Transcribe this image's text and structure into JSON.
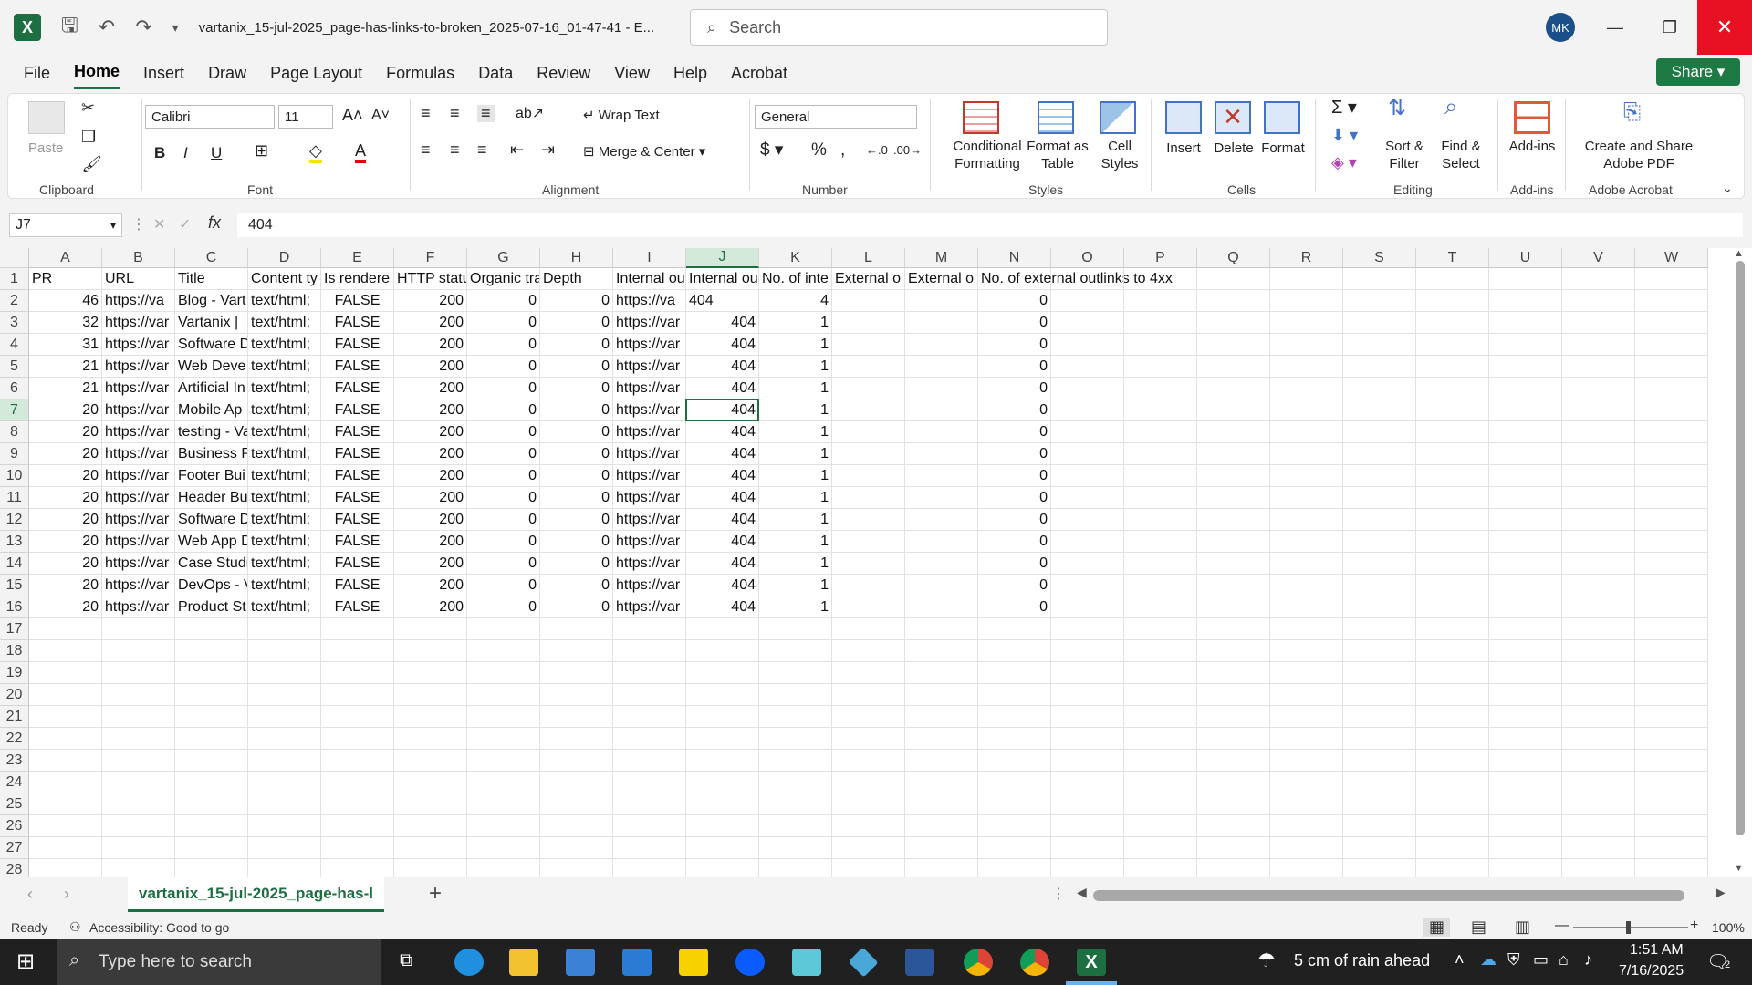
{
  "titlebar": {
    "doc_title": "vartanix_15-jul-2025_page-has-links-to-broken_2025-07-16_01-47-41  -  E...",
    "search_placeholder": "Search",
    "avatar_initials": "MK"
  },
  "menu": [
    "File",
    "Home",
    "Insert",
    "Draw",
    "Page Layout",
    "Formulas",
    "Data",
    "Review",
    "View",
    "Help",
    "Acrobat"
  ],
  "share_label": "Share",
  "ribbon": {
    "paste": "Paste",
    "font_name": "Calibri",
    "font_size": "11",
    "wrap_text": "Wrap Text",
    "merge_center": "Merge & Center",
    "number_format": "General",
    "conditional_formatting": "Conditional Formatting",
    "format_as_table": "Format as Table",
    "cell_styles": "Cell Styles",
    "insert": "Insert",
    "delete": "Delete",
    "format": "Format",
    "sort_filter": "Sort & Filter",
    "find_select": "Find & Select",
    "addins": "Add-ins",
    "create_pdf": "Create and Share Adobe PDF",
    "groups": {
      "clipboard": "Clipboard",
      "font": "Font",
      "alignment": "Alignment",
      "number": "Number",
      "styles": "Styles",
      "cells": "Cells",
      "editing": "Editing",
      "addins": "Add-ins",
      "acrobat": "Adobe Acrobat"
    }
  },
  "formula_bar": {
    "name_box": "J7",
    "fx": "fx",
    "content": "404"
  },
  "columns": [
    "A",
    "B",
    "C",
    "D",
    "E",
    "F",
    "G",
    "H",
    "I",
    "J",
    "K",
    "L",
    "M",
    "N",
    "O",
    "P",
    "Q",
    "R",
    "S",
    "T",
    "U",
    "V",
    "W"
  ],
  "header_row": [
    "PR",
    "URL",
    "Title",
    "Content ty",
    "Is rendere",
    "HTTP statu",
    "Organic tra",
    "Depth",
    "Internal ou",
    "Internal ou",
    "No. of inte",
    "External o",
    "External o",
    "No. of external outlinks to 4xx"
  ],
  "rows": [
    [
      "46",
      "https://va",
      "Blog - Vart",
      "text/html;",
      "FALSE",
      "200",
      "0",
      "0",
      "https://va",
      "404",
      "4",
      "",
      "",
      "0"
    ],
    [
      "32",
      "https://var",
      "Vartanix |",
      "text/html;",
      "FALSE",
      "200",
      "0",
      "0",
      "https://var",
      "404",
      "1",
      "",
      "",
      "0"
    ],
    [
      "31",
      "https://var",
      "Software D",
      "text/html;",
      "FALSE",
      "200",
      "0",
      "0",
      "https://var",
      "404",
      "1",
      "",
      "",
      "0"
    ],
    [
      "21",
      "https://var",
      "Web Deve",
      "text/html;",
      "FALSE",
      "200",
      "0",
      "0",
      "https://var",
      "404",
      "1",
      "",
      "",
      "0"
    ],
    [
      "21",
      "https://var",
      "Artificial In",
      "text/html;",
      "FALSE",
      "200",
      "0",
      "0",
      "https://var",
      "404",
      "1",
      "",
      "",
      "0"
    ],
    [
      "20",
      "https://var",
      "Mobile Ap",
      "text/html;",
      "FALSE",
      "200",
      "0",
      "0",
      "https://var",
      "404",
      "1",
      "",
      "",
      "0"
    ],
    [
      "20",
      "https://var",
      "testing - Va",
      "text/html;",
      "FALSE",
      "200",
      "0",
      "0",
      "https://var",
      "404",
      "1",
      "",
      "",
      "0"
    ],
    [
      "20",
      "https://var",
      "Business P",
      "text/html;",
      "FALSE",
      "200",
      "0",
      "0",
      "https://var",
      "404",
      "1",
      "",
      "",
      "0"
    ],
    [
      "20",
      "https://var",
      "Footer Bui",
      "text/html;",
      "FALSE",
      "200",
      "0",
      "0",
      "https://var",
      "404",
      "1",
      "",
      "",
      "0"
    ],
    [
      "20",
      "https://var",
      "Header Bu",
      "text/html;",
      "FALSE",
      "200",
      "0",
      "0",
      "https://var",
      "404",
      "1",
      "",
      "",
      "0"
    ],
    [
      "20",
      "https://var",
      "Software D",
      "text/html;",
      "FALSE",
      "200",
      "0",
      "0",
      "https://var",
      "404",
      "1",
      "",
      "",
      "0"
    ],
    [
      "20",
      "https://var",
      "Web App D",
      "text/html;",
      "FALSE",
      "200",
      "0",
      "0",
      "https://var",
      "404",
      "1",
      "",
      "",
      "0"
    ],
    [
      "20",
      "https://var",
      "Case Studi",
      "text/html;",
      "FALSE",
      "200",
      "0",
      "0",
      "https://var",
      "404",
      "1",
      "",
      "",
      "0"
    ],
    [
      "20",
      "https://var",
      "DevOps - V",
      "text/html;",
      "FALSE",
      "200",
      "0",
      "0",
      "https://var",
      "404",
      "1",
      "",
      "",
      "0"
    ],
    [
      "20",
      "https://var",
      "Product St",
      "text/html;",
      "FALSE",
      "200",
      "0",
      "0",
      "https://var",
      "404",
      "1",
      "",
      "",
      "0"
    ]
  ],
  "row_numbers": [
    "1",
    "2",
    "3",
    "4",
    "5",
    "6",
    "7",
    "8",
    "9",
    "10",
    "11",
    "12",
    "13",
    "14",
    "15",
    "16",
    "17",
    "18",
    "19",
    "20",
    "21",
    "22",
    "23",
    "24",
    "25",
    "26",
    "27",
    "28"
  ],
  "active_cell": {
    "col": "J",
    "row": "7"
  },
  "sheet_tab": "vartanix_15-jul-2025_page-has-l",
  "status": {
    "ready": "Ready",
    "accessibility": "Accessibility: Good to go",
    "zoom": "100%"
  },
  "taskbar": {
    "search_placeholder": "Type here to search",
    "weather": "5 cm of rain ahead",
    "time": "1:51 AM",
    "date": "7/16/2025",
    "notification_count": "2"
  },
  "colors": {
    "excel_green": "#1d6f42",
    "close_red": "#e81123",
    "taskbar": "#202020"
  }
}
